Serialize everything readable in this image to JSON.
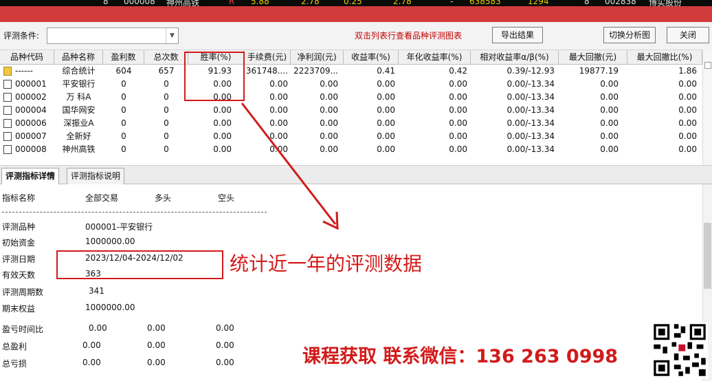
{
  "ticker": {
    "left_num": "8",
    "left_code": "000008",
    "left_name": "神州高铁",
    "left_flag": "R",
    "vals": [
      "5.88",
      "2.78",
      "0.25",
      "2.78"
    ],
    "dash": "-",
    "vol": "638583",
    "vol2": "1294",
    "right_num": "8",
    "right_code": "002838",
    "right_name": "博实股份"
  },
  "toolbar": {
    "condition_label": "评测条件:",
    "condition_value": "",
    "hint": "双击列表行查看品种评测图表",
    "export_label": "导出结果",
    "switch_label": "切换分析图",
    "close_label": "关闭"
  },
  "grid": {
    "columns": [
      "品种代码",
      "品种名称",
      "盈利数",
      "总次数",
      "胜率(%)",
      "手续费(元)",
      "净利润(元)",
      "收益率(%)",
      "年化收益率(%)",
      "相对收益率α/β(%)",
      "最大回撤(元)",
      "最大回撤比(%)"
    ],
    "rows": [
      {
        "code": "------",
        "name": "综合统计",
        "win": "604",
        "total": "657",
        "rate": "91.93",
        "fee": "361748....",
        "profit": "2223709...",
        "ret": "0.41",
        "annual": "0.42",
        "rel": "0.39/-12.93",
        "dd": "19877.19",
        "ddr": "1.86"
      },
      {
        "code": "000001",
        "name": "平安银行",
        "win": "0",
        "total": "0",
        "rate": "0.00",
        "fee": "0.00",
        "profit": "0.00",
        "ret": "0.00",
        "annual": "0.00",
        "rel": "0.00/-13.34",
        "dd": "0.00",
        "ddr": "0.00"
      },
      {
        "code": "000002",
        "name": "万 科A",
        "win": "0",
        "total": "0",
        "rate": "0.00",
        "fee": "0.00",
        "profit": "0.00",
        "ret": "0.00",
        "annual": "0.00",
        "rel": "0.00/-13.34",
        "dd": "0.00",
        "ddr": "0.00"
      },
      {
        "code": "000004",
        "name": "国华网安",
        "win": "0",
        "total": "0",
        "rate": "0.00",
        "fee": "0.00",
        "profit": "0.00",
        "ret": "0.00",
        "annual": "0.00",
        "rel": "0.00/-13.34",
        "dd": "0.00",
        "ddr": "0.00"
      },
      {
        "code": "000006",
        "name": "深振业A",
        "win": "0",
        "total": "0",
        "rate": "0.00",
        "fee": "0.00",
        "profit": "0.00",
        "ret": "0.00",
        "annual": "0.00",
        "rel": "0.00/-13.34",
        "dd": "0.00",
        "ddr": "0.00"
      },
      {
        "code": "000007",
        "name": "全新好",
        "win": "0",
        "total": "0",
        "rate": "0.00",
        "fee": "0.00",
        "profit": "0.00",
        "ret": "0.00",
        "annual": "0.00",
        "rel": "0.00/-13.34",
        "dd": "0.00",
        "ddr": "0.00"
      },
      {
        "code": "000008",
        "name": "神州高铁",
        "win": "0",
        "total": "0",
        "rate": "0.00",
        "fee": "0.00",
        "profit": "0.00",
        "ret": "0.00",
        "annual": "0.00",
        "rel": "0.00/-13.34",
        "dd": "0.00",
        "ddr": "0.00"
      }
    ]
  },
  "tabs": {
    "detail": "评测指标详情",
    "explain": "评测指标说明"
  },
  "detail": {
    "header": {
      "name": "指标名称",
      "all": "全部交易",
      "long": "多头",
      "short": "空头"
    },
    "items": [
      {
        "label": "评测品种",
        "value": "000001-平安银行"
      },
      {
        "label": "初始资金",
        "value": "1000000.00"
      },
      {
        "label": "评测日期",
        "value": "2023/12/04-2024/12/02"
      },
      {
        "label": "有效天数",
        "value": "363"
      },
      {
        "label": "评测周期数",
        "value": "341"
      },
      {
        "label": "期末权益",
        "value": "1000000.00"
      }
    ],
    "stats": [
      {
        "label": "盈亏时间比",
        "all": "0.00",
        "long": "0.00",
        "short": "0.00"
      },
      {
        "label": "总盈利",
        "all": "0.00",
        "long": "0.00",
        "short": "0.00"
      },
      {
        "label": "总亏损",
        "all": "0.00",
        "long": "0.00",
        "short": "0.00"
      }
    ]
  },
  "annotation": {
    "text": "统计近一年的评测数据",
    "contact": "课程获取 联系微信：136 263 0998"
  },
  "colors": {
    "accent_red": "#d21a1a",
    "titlebar": "#d23b3b",
    "hint_red": "#c00000"
  }
}
